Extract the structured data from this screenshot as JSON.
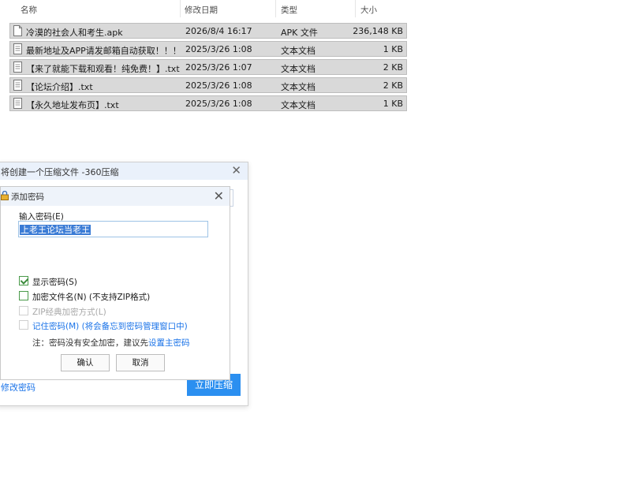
{
  "explorer": {
    "columns": {
      "name": "名称",
      "modified": "修改日期",
      "type": "类型",
      "size": "大小"
    },
    "files": [
      {
        "name": "冷漠的社会人和考生.apk",
        "modified": "2026/8/4 16:17",
        "type": "APK 文件",
        "size": "236,148 KB"
      },
      {
        "name": "最新地址及APP请发邮箱自动获取！！！....",
        "modified": "2025/3/26 1:08",
        "type": "文本文档",
        "size": "1 KB"
      },
      {
        "name": "【来了就能下载和观看！纯免费！】.txt",
        "modified": "2025/3/26 1:07",
        "type": "文本文档",
        "size": "2 KB"
      },
      {
        "name": "【论坛介绍】.txt",
        "modified": "2025/3/26 1:08",
        "type": "文本文档",
        "size": "2 KB"
      },
      {
        "name": "【永久地址发布页】.txt",
        "modified": "2025/3/26 1:08",
        "type": "文本文档",
        "size": "1 KB"
      }
    ]
  },
  "compress_window": {
    "title": "将创建一个压缩文件 -360压缩",
    "close": "✕",
    "modify_password_link": "修改密码",
    "compress_button": "立即压缩"
  },
  "password_dialog": {
    "title": "添加密码",
    "close": "✕",
    "enter_label": "输入密码(E)",
    "password_value": "上老王论坛当老王",
    "options": {
      "show_password": {
        "label": "显示密码(S)",
        "checked": true
      },
      "encrypt_filenames": {
        "label": "加密文件名(N) (不支持ZIP格式)",
        "checked": false
      },
      "zip_classic": {
        "label": "ZIP经典加密方式(L)",
        "checked": false,
        "disabled": true
      },
      "remember_password": {
        "label": "记住密码(M) (将会备忘到密码管理窗口中)",
        "checked": false
      }
    },
    "note_prefix": "注：密码没有安全加密，建议先",
    "note_link": "设置主密码",
    "ok_button": "确认",
    "cancel_button": "取消"
  }
}
